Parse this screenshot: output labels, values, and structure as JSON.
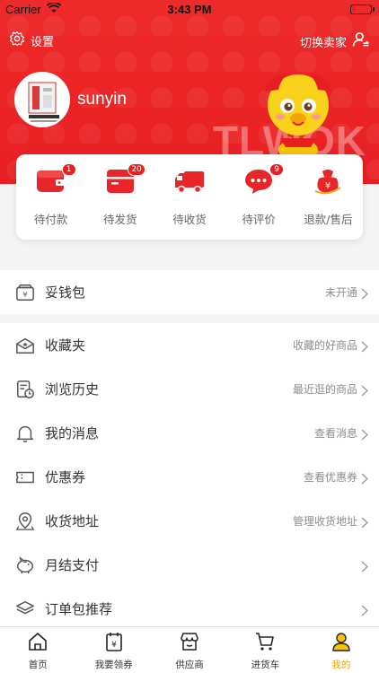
{
  "status_bar": {
    "carrier": "Carrier",
    "time": "3:43 PM"
  },
  "header": {
    "settings_label": "设置",
    "switch_label": "切换卖家",
    "username": "sunyin",
    "watermark": "TLWOK"
  },
  "orders": [
    {
      "label": "待付款",
      "badge": "1",
      "icon": "wallet-icon"
    },
    {
      "label": "待发货",
      "badge": "20",
      "icon": "package-icon"
    },
    {
      "label": "待收货",
      "badge": "",
      "icon": "truck-icon"
    },
    {
      "label": "待评价",
      "badge": "9",
      "icon": "comment-icon"
    },
    {
      "label": "退款/售后",
      "badge": "",
      "icon": "refund-icon"
    }
  ],
  "wallet": {
    "title": "妥钱包",
    "right": "未开通",
    "icon": "wallet-yen-icon"
  },
  "menu": [
    {
      "title": "收藏夹",
      "right": "收藏的好商品",
      "icon": "favorites-icon"
    },
    {
      "title": "浏览历史",
      "right": "最近逛的商品",
      "icon": "history-icon"
    },
    {
      "title": "我的消息",
      "right": "查看消息",
      "icon": "bell-icon"
    },
    {
      "title": "优惠券",
      "right": "查看优惠券",
      "icon": "coupon-icon"
    },
    {
      "title": "收货地址",
      "right": "管理收货地址",
      "icon": "location-icon"
    },
    {
      "title": "月结支付",
      "right": "",
      "icon": "piggy-bank-icon"
    },
    {
      "title": "订单包推荐",
      "right": "",
      "icon": "layers-icon"
    }
  ],
  "tabs": [
    {
      "label": "首页",
      "icon": "home-icon",
      "active": false
    },
    {
      "label": "我要领券",
      "icon": "calendar-icon",
      "active": false
    },
    {
      "label": "供应商",
      "icon": "shop-icon",
      "active": false
    },
    {
      "label": "进货车",
      "icon": "cart-icon",
      "active": false
    },
    {
      "label": "我的",
      "icon": "user-icon",
      "active": true
    }
  ],
  "colors": {
    "brand_red": "#e81f22",
    "active_tab": "#e0a800",
    "muted": "#8c8c8c"
  }
}
